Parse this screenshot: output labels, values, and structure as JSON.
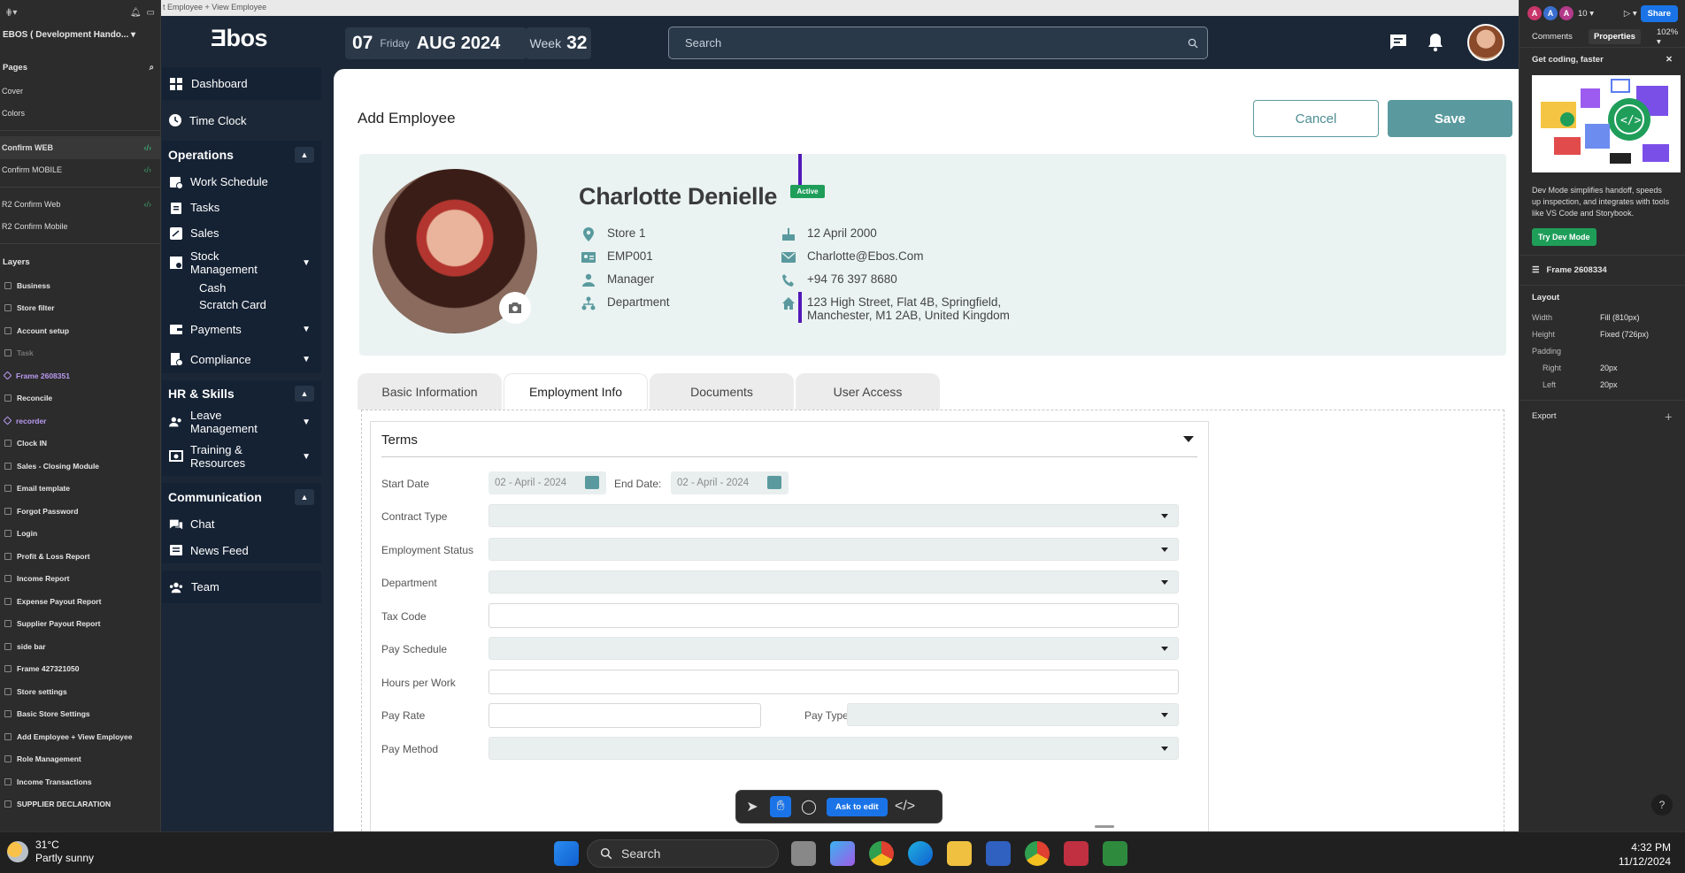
{
  "figma_left": {
    "file_name": "EBOS ( Development Hando...",
    "pages_title": "Pages",
    "pages": [
      {
        "label": "Cover",
        "code": false,
        "active": false
      },
      {
        "label": "Colors",
        "code": false,
        "active": false
      },
      {
        "label": "Confirm WEB",
        "code": true,
        "active": true
      },
      {
        "label": "Confirm  MOBILE",
        "code": true,
        "active": false
      },
      {
        "label": "R2 Confirm Web",
        "code": true,
        "active": false
      },
      {
        "label": "R2 Confirm Mobile",
        "code": false,
        "active": false
      }
    ],
    "layers_title": "Layers",
    "layers": [
      {
        "label": "Business",
        "style": ""
      },
      {
        "label": "Store filter",
        "style": ""
      },
      {
        "label": "Account setup",
        "style": ""
      },
      {
        "label": "Task",
        "style": "dim"
      },
      {
        "label": "Frame 2608351",
        "style": "purple"
      },
      {
        "label": "Reconcile",
        "style": ""
      },
      {
        "label": "recorder",
        "style": "purple"
      },
      {
        "label": "Clock IN",
        "style": ""
      },
      {
        "label": "Sales - Closing Module",
        "style": ""
      },
      {
        "label": "Email template",
        "style": ""
      },
      {
        "label": "Forgot Password",
        "style": ""
      },
      {
        "label": "Login",
        "style": ""
      },
      {
        "label": "Profit & Loss Report",
        "style": ""
      },
      {
        "label": "Income Report",
        "style": ""
      },
      {
        "label": "Expense Payout Report",
        "style": ""
      },
      {
        "label": "Supplier Payout Report",
        "style": ""
      },
      {
        "label": "side bar",
        "style": ""
      },
      {
        "label": "Frame 427321050",
        "style": ""
      },
      {
        "label": "Store settings",
        "style": ""
      },
      {
        "label": "Basic Store Settings",
        "style": ""
      },
      {
        "label": "Add Employee + View Employee",
        "style": ""
      },
      {
        "label": "Role Management",
        "style": ""
      },
      {
        "label": "Income Transactions",
        "style": ""
      },
      {
        "label": "SUPPLIER DECLARATION",
        "style": ""
      }
    ]
  },
  "canvas": {
    "breadcrumb": "t Employee + View Employee"
  },
  "header": {
    "logo": "Ǝbos",
    "day": "07",
    "weekday": "Friday",
    "month_year": "AUG 2024",
    "week_label": "Week",
    "week_number": "32",
    "search_placeholder": "Search"
  },
  "nav": {
    "dashboard": "Dashboard",
    "time_clock": "Time Clock",
    "operations": "Operations",
    "work_schedule": "Work Schedule",
    "tasks": "Tasks",
    "sales": "Sales",
    "stock_management": "Stock Management",
    "cash": "Cash",
    "scratch_card": "Scratch Card",
    "payments": "Payments",
    "compliance": "Compliance",
    "hr_skills": "HR & Skills",
    "leave_management": "Leave Management",
    "training": "Training & Resources",
    "communication": "Communication",
    "chat": "Chat",
    "news_feed": "News Feed",
    "team": "Team"
  },
  "page": {
    "title": "Add Employee",
    "cancel": "Cancel",
    "save": "Save"
  },
  "profile": {
    "name": "Charlotte Denielle",
    "status": "Active",
    "store": "Store 1",
    "employee_id": "EMP001",
    "role": "Manager",
    "department": "Department",
    "dob": "12 April 2000",
    "email": "Charlotte@Ebos.Com",
    "phone": "+94 76 397 8680",
    "address_line1": "123 High Street, Flat 4B, Springfield,",
    "address_line2": "Manchester, M1 2AB, United Kingdom"
  },
  "tabs": [
    "Basic Information",
    "Employment Info",
    "Documents",
    "User Access"
  ],
  "terms": {
    "title": "Terms",
    "start_date_label": "Start Date",
    "start_date": "02 - April - 2024",
    "end_date_label": "End Date:",
    "end_date": "02 - April - 2024",
    "contract_type": "Contract Type",
    "employment_status": "Employment Status",
    "department": "Department",
    "tax_code": "Tax Code",
    "pay_schedule": "Pay Schedule",
    "hours_per_work": "Hours per Work",
    "pay_rate": "Pay Rate",
    "pay_type": "Pay Type",
    "pay_method": "Pay Method"
  },
  "toolbar": {
    "ask": "Ask to edit"
  },
  "figma_right": {
    "avatars": [
      "A",
      "A",
      "A"
    ],
    "collab_count": "10",
    "share": "Share",
    "tab_comments": "Comments",
    "tab_properties": "Properties",
    "zoom": "102%",
    "promo_title": "Get coding, faster",
    "promo_text": "Dev Mode simplifies handoff, speeds up inspection, and integrates with tools like VS Code and Storybook.",
    "promo_button": "Try Dev Mode",
    "frame_name": "Frame 2608334",
    "layout_title": "Layout",
    "width_label": "Width",
    "width_value": "Fill (810px)",
    "height_label": "Height",
    "height_value": "Fixed (726px)",
    "padding_label": "Padding",
    "right_label": "Right",
    "right_value": "20px",
    "left_label": "Left",
    "left_value": "20px",
    "export_label": "Export"
  },
  "taskbar": {
    "temp": "31°C",
    "weather": "Partly sunny",
    "search": "Search",
    "time": "4:32 PM",
    "date": "11/12/2024"
  },
  "colors": {
    "accent": "#5a9a9e",
    "nav_bg": "#1b2736",
    "active_badge": "#1f9e5a",
    "divider": "#5418b9"
  }
}
